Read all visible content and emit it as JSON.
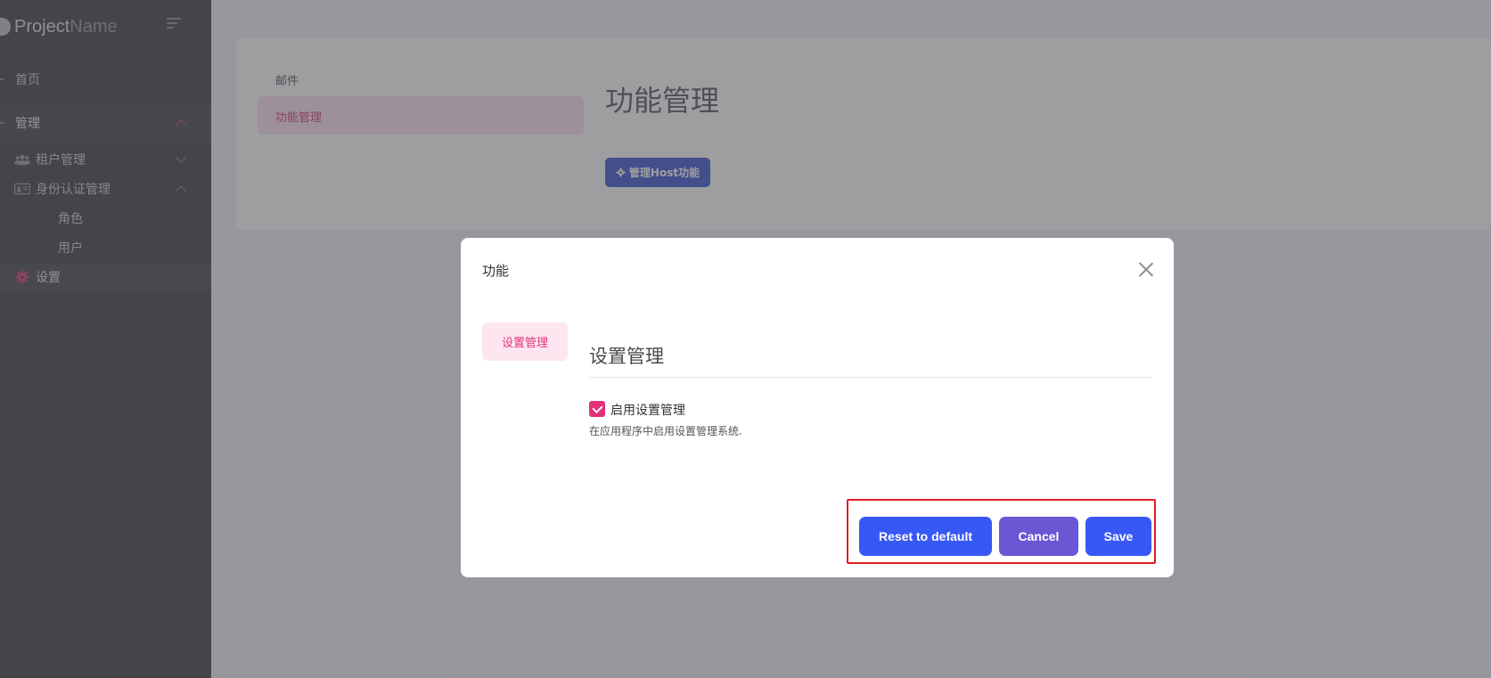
{
  "sidebar": {
    "brand_bold": "Project",
    "brand_light": "Name",
    "items": [
      {
        "label": "首页"
      },
      {
        "label": "管理"
      },
      {
        "label": "租户管理"
      },
      {
        "label": "身份认证管理"
      },
      {
        "label": "角色"
      },
      {
        "label": "用户"
      },
      {
        "label": "设置"
      }
    ]
  },
  "main": {
    "tabs": [
      {
        "label": "邮件"
      },
      {
        "label": "功能管理"
      }
    ],
    "title": "功能管理",
    "host_button": "管理Host功能"
  },
  "modal": {
    "title": "功能",
    "tab": "设置管理",
    "section_title": "设置管理",
    "checkbox_label": "启用设置管理",
    "checkbox_checked": true,
    "help_text": "在应用程序中启用设置管理系统.",
    "buttons": {
      "reset": "Reset to default",
      "cancel": "Cancel",
      "save": "Save"
    }
  },
  "colors": {
    "accent_pink": "#e0558c",
    "primary_blue": "#3858f6",
    "cancel_purple": "#6a57d4",
    "highlight_red": "#e51c23"
  }
}
